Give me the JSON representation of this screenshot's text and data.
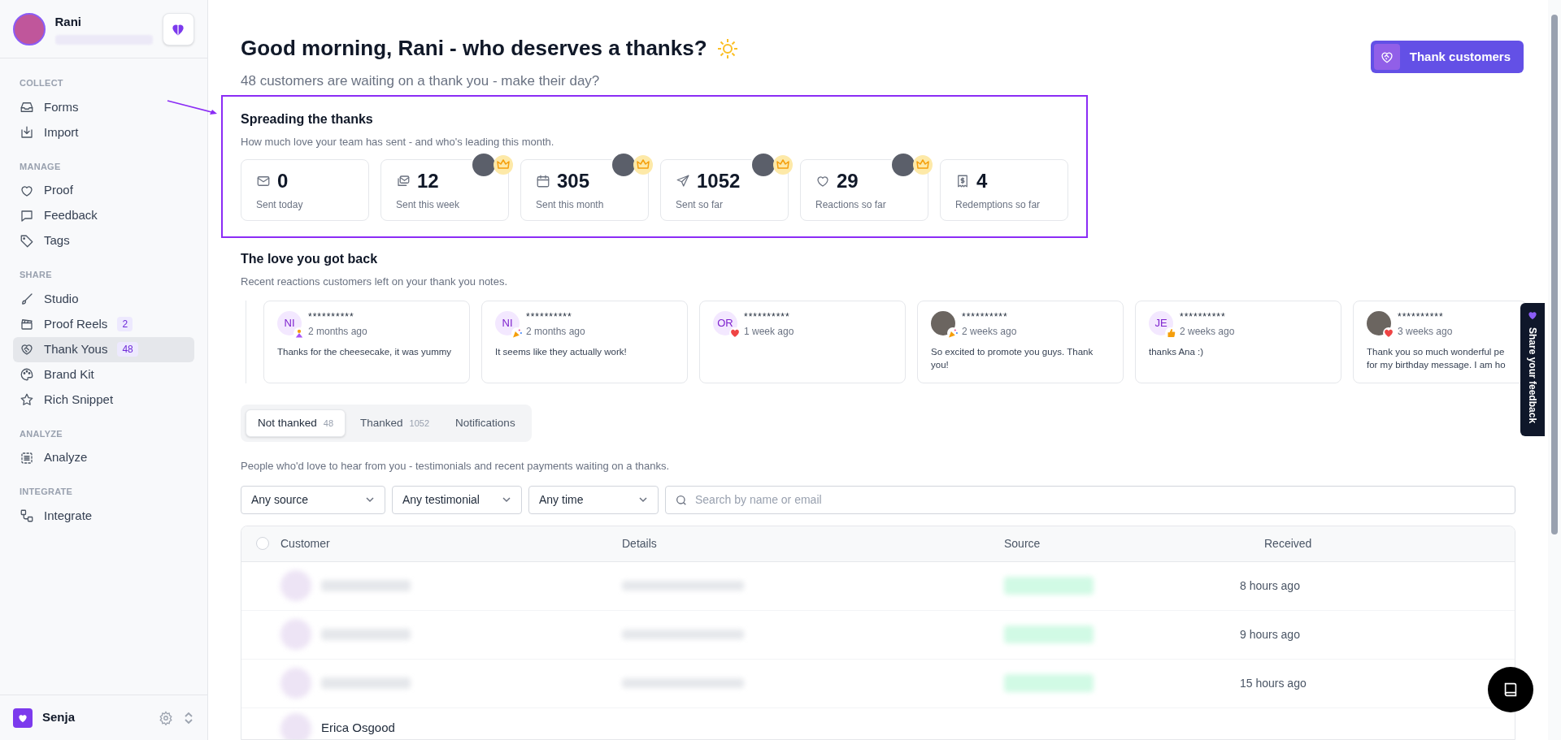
{
  "sidebar": {
    "user": {
      "name": "Rani"
    },
    "sections": [
      {
        "title": "COLLECT",
        "items": [
          {
            "label": "Forms",
            "selected": false
          },
          {
            "label": "Import",
            "selected": false
          }
        ]
      },
      {
        "title": "MANAGE",
        "items": [
          {
            "label": "Proof",
            "selected": false
          },
          {
            "label": "Feedback",
            "selected": false
          },
          {
            "label": "Tags",
            "selected": false
          }
        ]
      },
      {
        "title": "SHARE",
        "items": [
          {
            "label": "Studio",
            "selected": false
          },
          {
            "label": "Proof Reels",
            "badge": "2",
            "selected": false
          },
          {
            "label": "Thank Yous",
            "badge": "48",
            "selected": true
          },
          {
            "label": "Brand Kit",
            "selected": false
          },
          {
            "label": "Rich Snippet",
            "selected": false
          }
        ]
      },
      {
        "title": "ANALYZE",
        "items": [
          {
            "label": "Analyze",
            "selected": false
          }
        ]
      },
      {
        "title": "INTEGRATE",
        "items": [
          {
            "label": "Integrate",
            "selected": false
          }
        ]
      }
    ],
    "workspace": {
      "name": "Senja"
    }
  },
  "header": {
    "title": "Good morning, Rani - who deserves a thanks?",
    "subtitle": "48 customers are waiting on a thank you - make their day?",
    "action": "Thank customers"
  },
  "stats": {
    "title": "Spreading the thanks",
    "subtitle": "How much love your team has sent - and who's leading this month.",
    "items": [
      {
        "value": "0",
        "label": "Sent today",
        "leader": false
      },
      {
        "value": "12",
        "label": "Sent this week",
        "leader": true
      },
      {
        "value": "305",
        "label": "Sent this month",
        "leader": true
      },
      {
        "value": "1052",
        "label": "Sent so far",
        "leader": true
      },
      {
        "value": "29",
        "label": "Reactions so far",
        "leader": true
      },
      {
        "value": "4",
        "label": "Redemptions so far",
        "leader": false
      }
    ]
  },
  "reactions": {
    "title": "The love you got back",
    "subtitle": "Recent reactions customers left on your thank you notes.",
    "items": [
      {
        "kind": "initials",
        "initials": "NI",
        "name": "**********",
        "time": "2 months ago",
        "message": "Thanks for the cheesecake, it was yummy"
      },
      {
        "kind": "initials",
        "initials": "NI",
        "name": "**********",
        "time": "2 months ago",
        "message": "It seems like they actually work!"
      },
      {
        "kind": "initials",
        "initials": "OR",
        "name": "**********",
        "time": "1 week ago"
      },
      {
        "kind": "photo",
        "name": "**********",
        "time": "2 weeks ago",
        "message": "So excited to promote you guys. Thank you!"
      },
      {
        "kind": "initials",
        "initials": "JE",
        "name": "**********",
        "time": "2 weeks ago",
        "message": "thanks Ana :)"
      },
      {
        "kind": "photo",
        "name": "**********",
        "time": "3 weeks ago",
        "message": "Thank you so much wonderful pe for my birthday message. I am ho"
      }
    ]
  },
  "tabs": [
    {
      "label": "Not thanked",
      "count": "48",
      "selected": true
    },
    {
      "label": "Thanked",
      "count": "1052",
      "selected": false
    },
    {
      "label": "Notifications",
      "selected": false
    }
  ],
  "description": "People who'd love to hear from you - testimonials and recent payments waiting on a thanks.",
  "filters": [
    {
      "value": "Any source"
    },
    {
      "value": "Any testimonial"
    },
    {
      "value": "Any time"
    }
  ],
  "search": {
    "placeholder": "Search by name or email"
  },
  "table": {
    "select_all": {
      "checked": false
    },
    "columns": [
      "Customer",
      "Details",
      "Source",
      "Received"
    ],
    "rows": [
      {
        "received": "8 hours ago"
      },
      {
        "received": "9 hours ago"
      },
      {
        "received": "15 hours ago"
      },
      {
        "customer": "Erica Osgood"
      }
    ]
  },
  "feedback_tab": "Share your feedback"
}
